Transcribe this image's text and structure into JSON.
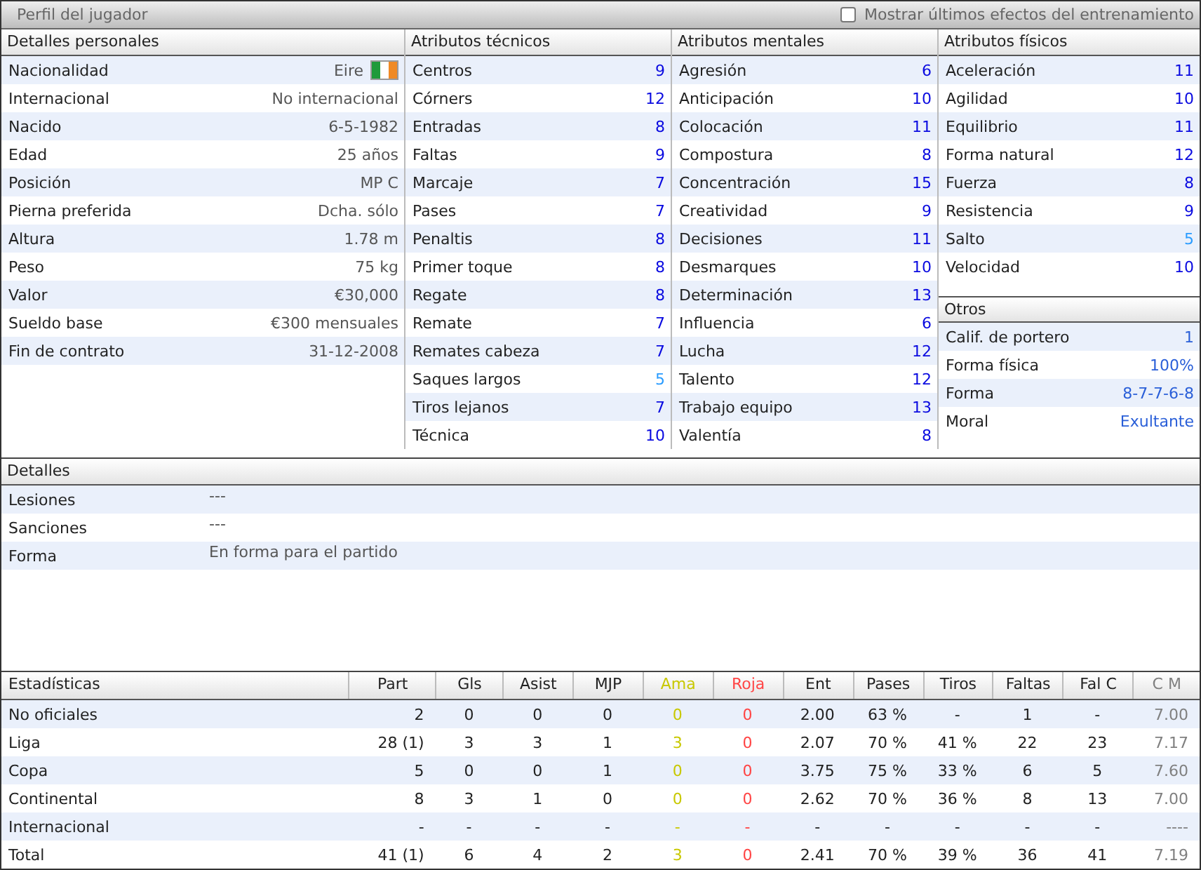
{
  "title": "Perfil del jugador",
  "training_toggle": {
    "label": "Mostrar últimos efectos del entrenamiento",
    "checked": false
  },
  "personal": {
    "title": "Detalles personales",
    "rows": [
      {
        "kind": "nationality",
        "label": "Nacionalidad",
        "value": "Eire"
      },
      {
        "kind": "text",
        "label": "Internacional",
        "value": "No internacional"
      },
      {
        "kind": "text",
        "label": "Nacido",
        "value": "6-5-1982"
      },
      {
        "kind": "text",
        "label": "Edad",
        "value": "25 años"
      },
      {
        "kind": "text",
        "label": "Posición",
        "value": "MP C"
      },
      {
        "kind": "text",
        "label": "Pierna preferida",
        "value": "Dcha. sólo"
      },
      {
        "kind": "text",
        "label": "Altura",
        "value": "1.78 m"
      },
      {
        "kind": "text",
        "label": "Peso",
        "value": "75 kg"
      },
      {
        "kind": "text",
        "label": "Valor",
        "value": "€30,000"
      },
      {
        "kind": "text",
        "label": "Sueldo base",
        "value": "€300 mensuales"
      },
      {
        "kind": "text",
        "label": "Fin de contrato",
        "value": "31-12-2008"
      }
    ]
  },
  "technical": {
    "title": "Atributos técnicos",
    "items": [
      {
        "label": "Centros",
        "value": "9",
        "color": "#0a0ae0"
      },
      {
        "label": "Córners",
        "value": "12",
        "color": "#0a0ae0"
      },
      {
        "label": "Entradas",
        "value": "8",
        "color": "#0a0ae0"
      },
      {
        "label": "Faltas",
        "value": "9",
        "color": "#0a0ae0"
      },
      {
        "label": "Marcaje",
        "value": "7",
        "color": "#0a0ae0"
      },
      {
        "label": "Pases",
        "value": "7",
        "color": "#0a0ae0"
      },
      {
        "label": "Penaltis",
        "value": "8",
        "color": "#0a0ae0"
      },
      {
        "label": "Primer toque",
        "value": "8",
        "color": "#0a0ae0"
      },
      {
        "label": "Regate",
        "value": "8",
        "color": "#0a0ae0"
      },
      {
        "label": "Remate",
        "value": "7",
        "color": "#0a0ae0"
      },
      {
        "label": "Remates cabeza",
        "value": "7",
        "color": "#0a0ae0"
      },
      {
        "label": "Saques largos",
        "value": "5",
        "color": "#2a9cff"
      },
      {
        "label": "Tiros lejanos",
        "value": "7",
        "color": "#0a0ae0"
      },
      {
        "label": "Técnica",
        "value": "10",
        "color": "#0a0ae0"
      }
    ]
  },
  "mental": {
    "title": "Atributos mentales",
    "items": [
      {
        "label": "Agresión",
        "value": "6",
        "color": "#0a0ae0"
      },
      {
        "label": "Anticipación",
        "value": "10",
        "color": "#0a0ae0"
      },
      {
        "label": "Colocación",
        "value": "11",
        "color": "#0a0ae0"
      },
      {
        "label": "Compostura",
        "value": "8",
        "color": "#0a0ae0"
      },
      {
        "label": "Concentración",
        "value": "15",
        "color": "#0a0ae0"
      },
      {
        "label": "Creatividad",
        "value": "9",
        "color": "#0a0ae0"
      },
      {
        "label": "Decisiones",
        "value": "11",
        "color": "#0a0ae0"
      },
      {
        "label": "Desmarques",
        "value": "10",
        "color": "#0a0ae0"
      },
      {
        "label": "Determinación",
        "value": "13",
        "color": "#0a0ae0"
      },
      {
        "label": "Influencia",
        "value": "6",
        "color": "#0a0ae0"
      },
      {
        "label": "Lucha",
        "value": "12",
        "color": "#0a0ae0"
      },
      {
        "label": "Talento",
        "value": "12",
        "color": "#0a0ae0"
      },
      {
        "label": "Trabajo equipo",
        "value": "13",
        "color": "#0a0ae0"
      },
      {
        "label": "Valentía",
        "value": "8",
        "color": "#0a0ae0"
      }
    ]
  },
  "physical": {
    "title": "Atributos físicos",
    "items": [
      {
        "label": "Aceleración",
        "value": "11",
        "color": "#0a0ae0"
      },
      {
        "label": "Agilidad",
        "value": "10",
        "color": "#0a0ae0"
      },
      {
        "label": "Equilibrio",
        "value": "11",
        "color": "#0a0ae0"
      },
      {
        "label": "Forma natural",
        "value": "12",
        "color": "#0a0ae0"
      },
      {
        "label": "Fuerza",
        "value": "8",
        "color": "#0a0ae0"
      },
      {
        "label": "Resistencia",
        "value": "9",
        "color": "#0a0ae0"
      },
      {
        "label": "Salto",
        "value": "5",
        "color": "#2a9cff"
      },
      {
        "label": "Velocidad",
        "value": "10",
        "color": "#0a0ae0"
      }
    ]
  },
  "others": {
    "title": "Otros",
    "items": [
      {
        "label": "Calif. de portero",
        "value": "1",
        "color": "#2a5fd8"
      },
      {
        "label": "Forma física",
        "value": "100%",
        "color": "#2a5fd8"
      },
      {
        "label": "Forma",
        "value": "8-7-7-6-8",
        "color": "#2a5fd8"
      },
      {
        "label": "Moral",
        "value": "Exultante",
        "color": "#2a5fd8"
      }
    ]
  },
  "details": {
    "title": "Detalles",
    "rows": [
      {
        "label": "Lesiones",
        "value": "---"
      },
      {
        "label": "Sanciones",
        "value": "---"
      },
      {
        "label": "Forma",
        "value": "En forma para el partido"
      }
    ]
  },
  "stats": {
    "columns": [
      {
        "label": "Estadísticas",
        "color": "#222222"
      },
      {
        "label": "Part",
        "color": "#222222"
      },
      {
        "label": "Gls",
        "color": "#222222"
      },
      {
        "label": "Asist",
        "color": "#222222"
      },
      {
        "label": "MJP",
        "color": "#222222"
      },
      {
        "label": "Ama",
        "color": "#c8c800"
      },
      {
        "label": "Roja",
        "color": "#ff4444"
      },
      {
        "label": "Ent",
        "color": "#222222"
      },
      {
        "label": "Pases",
        "color": "#222222"
      },
      {
        "label": "Tiros",
        "color": "#222222"
      },
      {
        "label": "Faltas",
        "color": "#222222"
      },
      {
        "label": "Fal C",
        "color": "#222222"
      },
      {
        "label": "C M",
        "color": "#808080"
      }
    ],
    "rows": [
      [
        "No oficiales",
        "2",
        "0",
        "0",
        "0",
        "0",
        "0",
        "2.00",
        "63 %",
        "-",
        "1",
        "-",
        "7.00"
      ],
      [
        "Liga",
        "28 (1)",
        "3",
        "3",
        "1",
        "3",
        "0",
        "2.07",
        "70 %",
        "41 %",
        "22",
        "23",
        "7.17"
      ],
      [
        "Copa",
        "5",
        "0",
        "0",
        "1",
        "0",
        "0",
        "3.75",
        "75 %",
        "33 %",
        "6",
        "5",
        "7.60"
      ],
      [
        "Continental",
        "8",
        "3",
        "1",
        "0",
        "0",
        "0",
        "2.62",
        "70 %",
        "36 %",
        "8",
        "13",
        "7.00"
      ],
      [
        "Internacional",
        "-",
        "-",
        "-",
        "-",
        "-",
        "-",
        "-",
        "-",
        "-",
        "-",
        "-",
        "----"
      ],
      [
        "Total",
        "41 (1)",
        "6",
        "4",
        "2",
        "3",
        "0",
        "2.41",
        "70 %",
        "39 %",
        "36",
        "41",
        "7.19"
      ]
    ]
  }
}
